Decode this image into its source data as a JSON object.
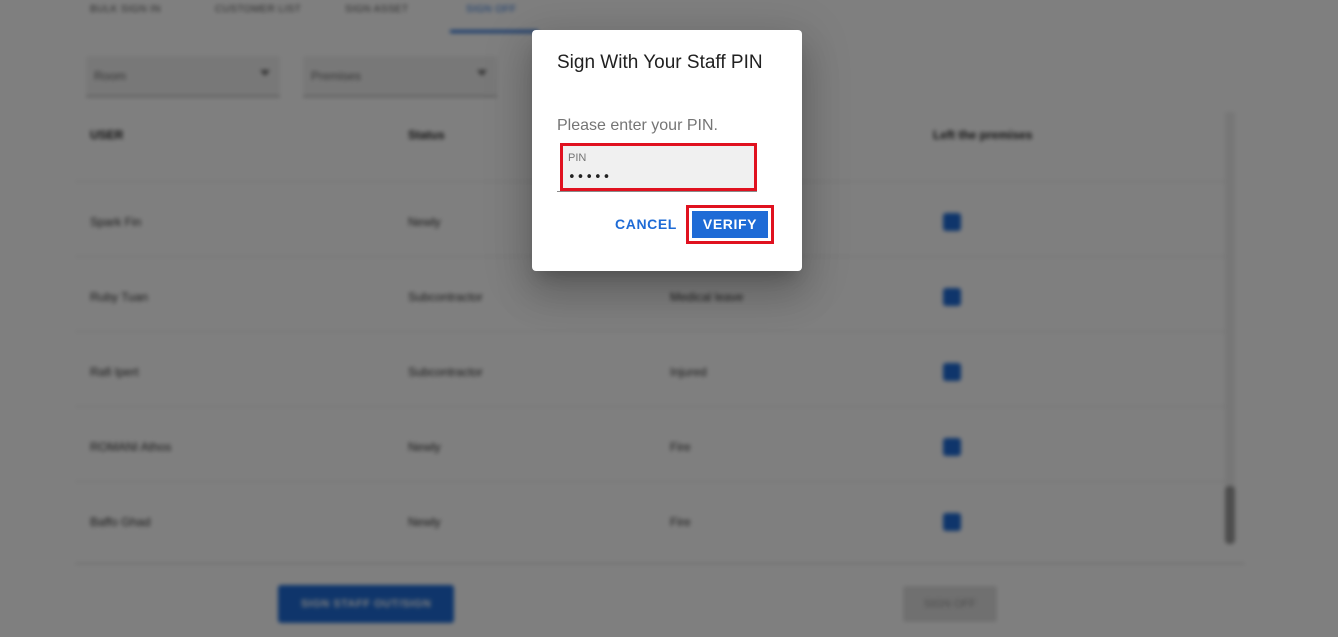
{
  "background": {
    "tabs": [
      "BULK SIGN IN",
      "CUSTOMER LIST",
      "SIGN ASSET",
      "SIGN OFF"
    ],
    "active_tab": 3,
    "filters": [
      {
        "placeholder": "Room"
      },
      {
        "placeholder": "Premises"
      }
    ],
    "columns": [
      "USER",
      "Status",
      "",
      "Left the premises"
    ],
    "rows": [
      {
        "user": "Spark Fin",
        "status": "Newly",
        "reason": ""
      },
      {
        "user": "Ruby Tuan",
        "status": "Subcontractor",
        "reason": "Medical leave"
      },
      {
        "user": "Rafi Ipert",
        "status": "Subcontractor",
        "reason": "Injured"
      },
      {
        "user": "ROMANI Athos",
        "status": "Newly",
        "reason": "Fire"
      },
      {
        "user": "Baffo Ghad",
        "status": "Newly",
        "reason": "Fire"
      }
    ],
    "primary_button": "SIGN STAFF OUT/SIGN",
    "secondary_button": "SIGN OFF"
  },
  "dialog": {
    "title": "Sign With Your Staff PIN",
    "message": "Please enter your PIN.",
    "pin_label": "PIN",
    "pin_value": "•••••",
    "cancel_label": "CANCEL",
    "verify_label": "VERIFY"
  },
  "colors": {
    "accent": "#1e6bd6",
    "highlight": "#e0111f",
    "overlay": "rgba(0,0,0,0.5)"
  }
}
